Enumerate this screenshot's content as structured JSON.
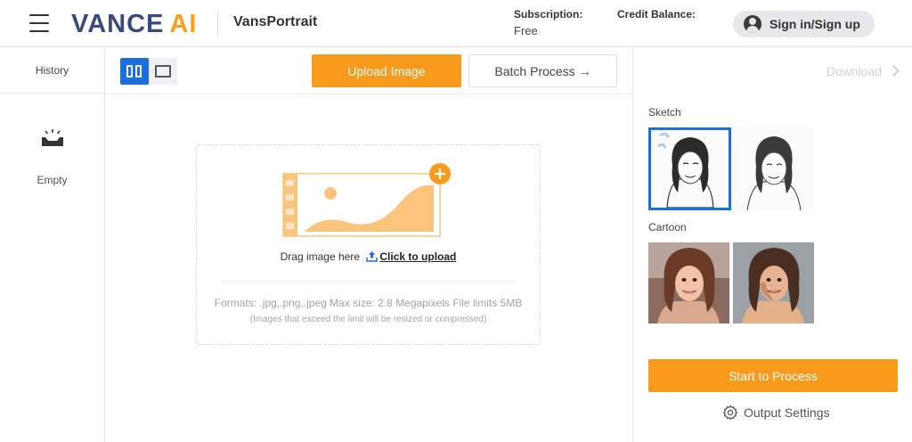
{
  "header": {
    "logo_left": "VANCE",
    "logo_right": "AI",
    "product_name": "VansPortrait",
    "subscription_label": "Subscription:",
    "subscription_value": "Free",
    "credit_label": "Credit Balance:",
    "signin_label": "Sign in/Sign up"
  },
  "sidebar": {
    "history_label": "History",
    "empty_label": "Empty"
  },
  "toolbar": {
    "upload_label": "Upload Image",
    "batch_label": "Batch Process →"
  },
  "dropzone": {
    "drag_text": "Drag image here",
    "click_text": "Click to upload",
    "formats_text": "Formats: .jpg,.png,.jpeg Max size: 2.8 Megapixels File limits 5MB",
    "note_text": "(Images that exceed the limit will be resized or compressed)"
  },
  "right_panel": {
    "download_label": "Download",
    "sketch_label": "Sketch",
    "cartoon_label": "Cartoon",
    "process_label": "Start to Process",
    "output_settings_label": "Output Settings"
  },
  "colors": {
    "accent_orange": "#f89a1c",
    "accent_blue": "#1a6fe0",
    "logo_navy": "#3a4a7c"
  },
  "icons": [
    "menu-icon",
    "user-icon",
    "split-view-icon",
    "single-view-icon",
    "empty-tray-icon",
    "image-placeholder-icon",
    "add-icon",
    "upload-icon",
    "chevron-right-icon",
    "gear-icon"
  ]
}
